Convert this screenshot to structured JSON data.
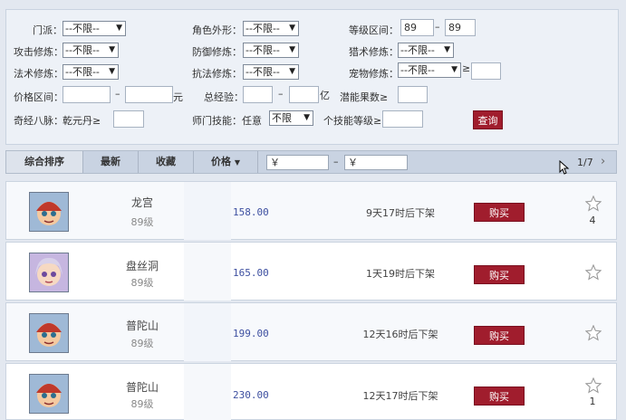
{
  "filters": {
    "menpai_label": "门派：",
    "unlimited": "--不限--",
    "appearance_label": "角色外形：",
    "level_label": "等级区间：",
    "level_min": "89",
    "level_max": "89",
    "dash": "–",
    "attack_label": "攻击修炼：",
    "defense_label": "防御修炼：",
    "hunt_label": "猎术修炼：",
    "magic_label": "法术修炼：",
    "resist_label": "抗法修炼：",
    "pet_label": "宠物修炼：",
    "gte": "≥",
    "price_label": "价格区间：",
    "yuan": "元",
    "exp_label": "总经验：",
    "yi": "亿",
    "potential_label": "潜能果数≥",
    "meridian_label": "奇经八脉：",
    "qianyuan_label": "乾元丹≥",
    "school_skill_label": "师门技能：",
    "any": "任意",
    "unlimited_short": "不限",
    "skill_level_label": "个技能等级≥",
    "query_button": "查询"
  },
  "tabs": {
    "overall": "综合排序",
    "newest": "最新",
    "favorite": "收藏",
    "price": "价格",
    "yen": "￥",
    "dash": "–",
    "pager": "1/7"
  },
  "listings": [
    {
      "name": "龙宫",
      "level": "89级",
      "price": "158.00",
      "time": "9天17时后下架",
      "buy": "购买",
      "fav_count": "4"
    },
    {
      "name": "盘丝洞",
      "level": "89级",
      "price": "165.00",
      "time": "1天19时后下架",
      "buy": "购买",
      "fav_count": ""
    },
    {
      "name": "普陀山",
      "level": "89级",
      "price": "199.00",
      "time": "12天16时后下架",
      "buy": "购买",
      "fav_count": ""
    },
    {
      "name": "普陀山",
      "level": "89级",
      "price": "230.00",
      "time": "12天17时后下架",
      "buy": "购买",
      "fav_count": "1"
    }
  ],
  "colors": {
    "accent": "#a01d2d",
    "price": "#3d4fa0"
  }
}
